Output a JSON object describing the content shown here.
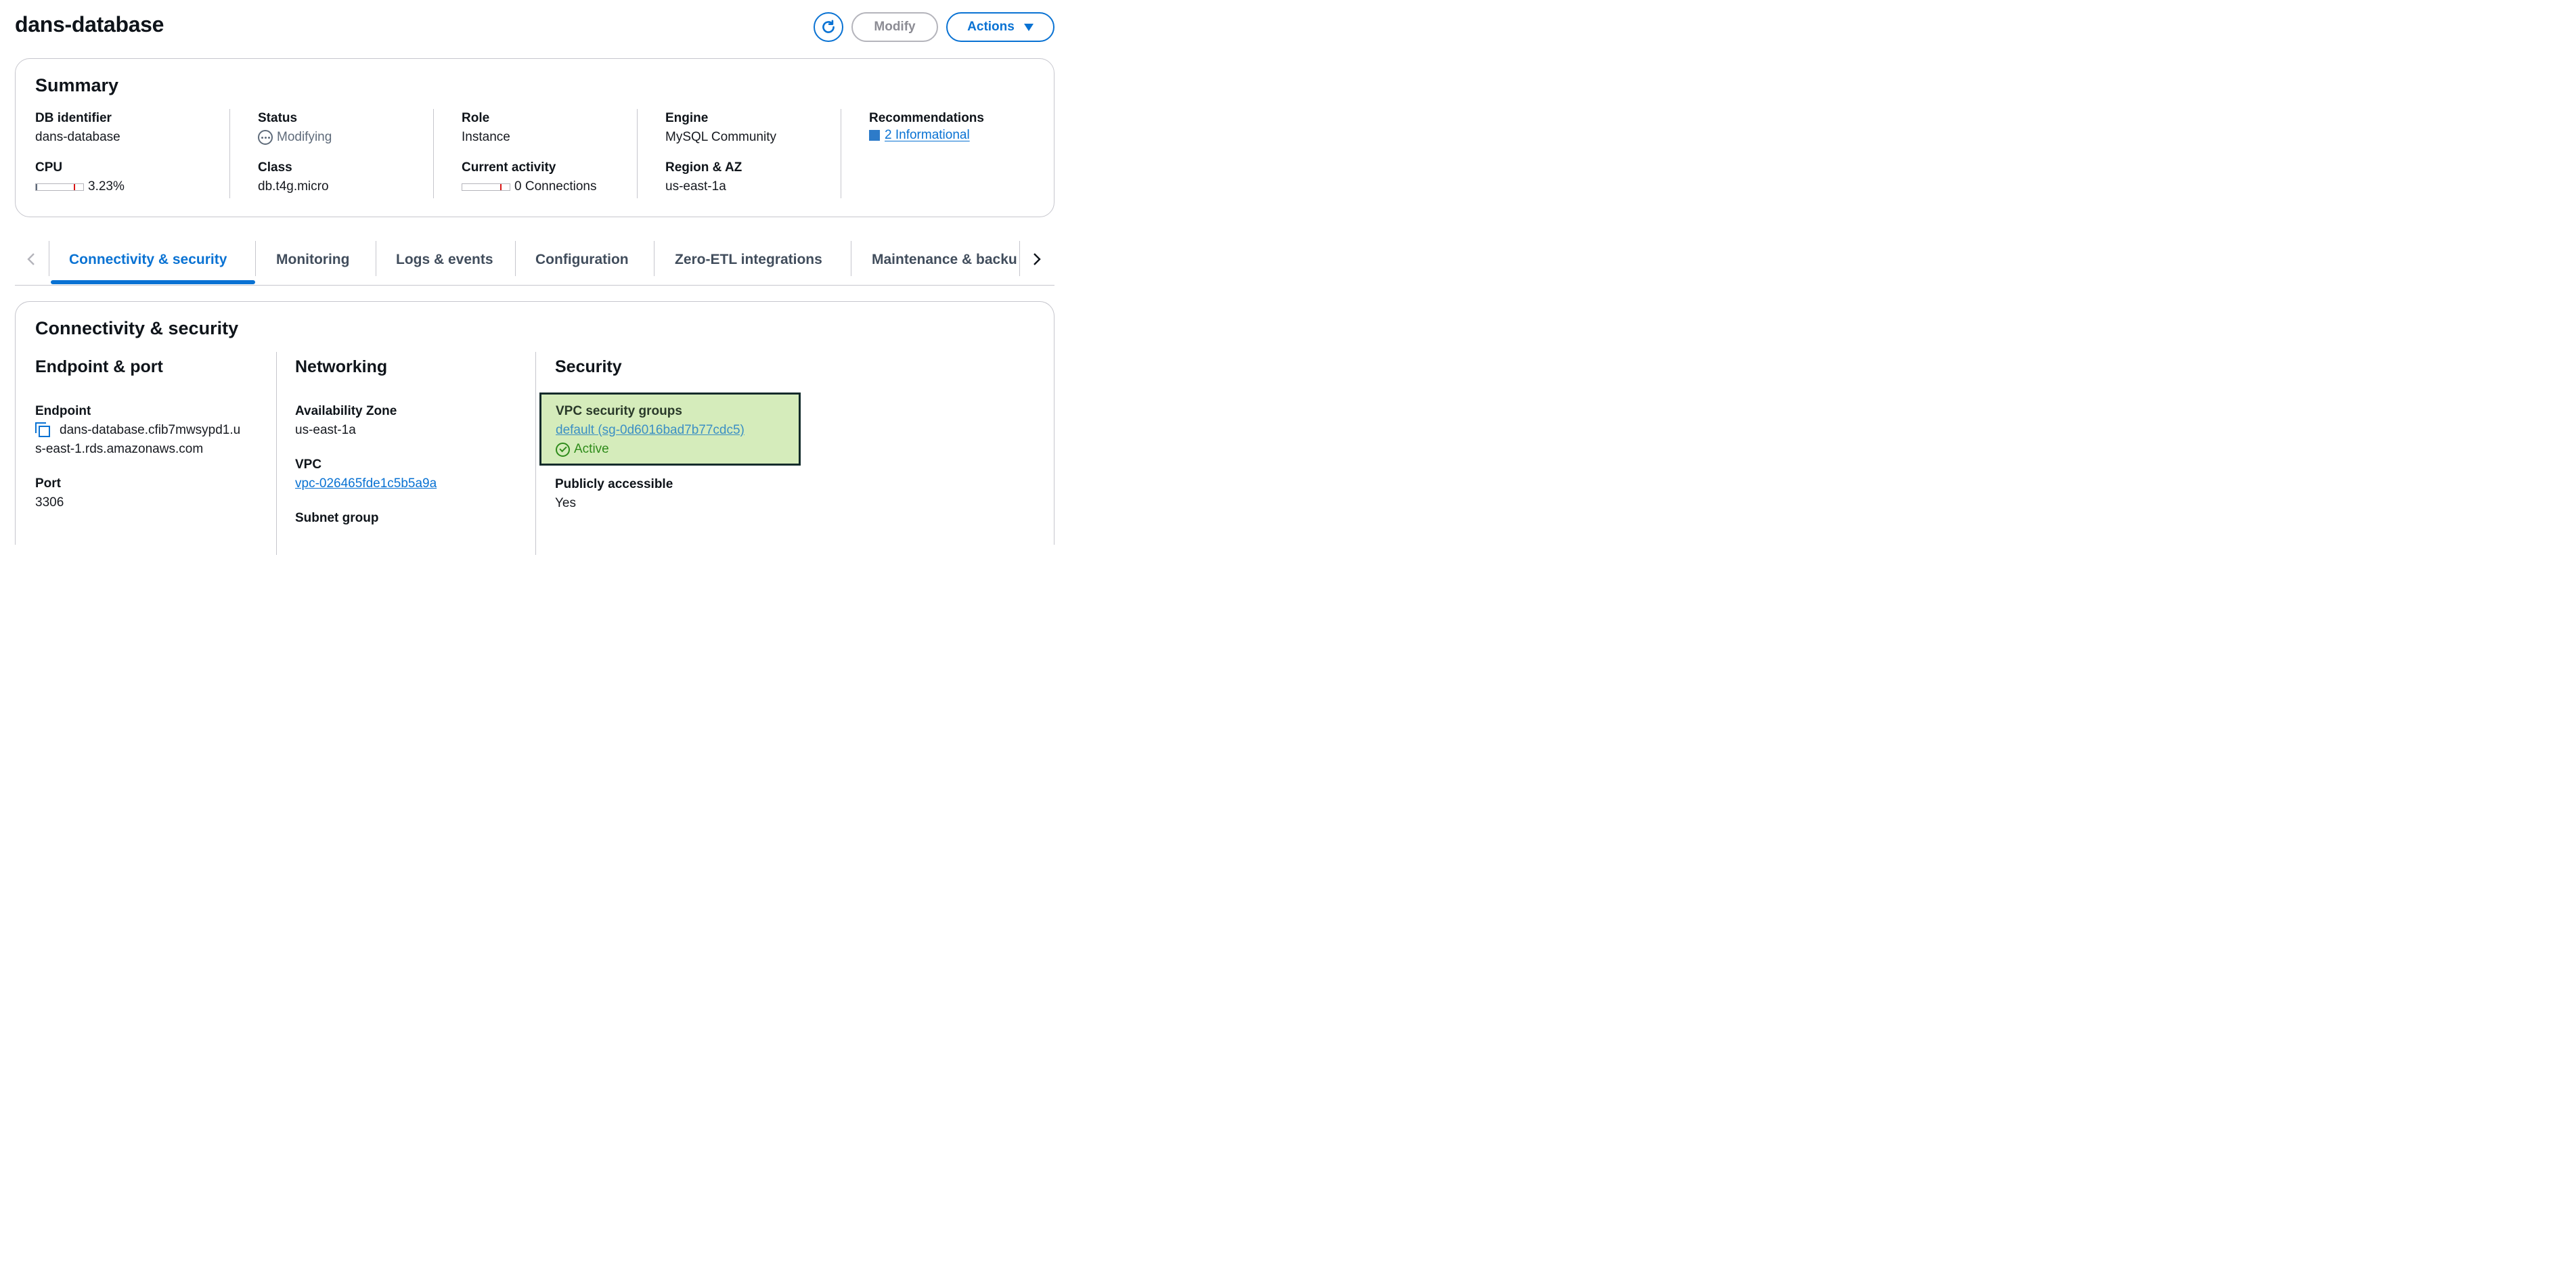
{
  "page": {
    "title": "dans-database"
  },
  "header": {
    "refresh_icon": "refresh-icon",
    "modify_label": "Modify",
    "actions_label": "Actions"
  },
  "summary": {
    "title": "Summary",
    "db_identifier_label": "DB identifier",
    "db_identifier_value": "dans-database",
    "cpu_label": "CPU",
    "cpu_value": "3.23%",
    "cpu_percent": 3.23,
    "status_label": "Status",
    "status_value": "Modifying",
    "class_label": "Class",
    "class_value": "db.t4g.micro",
    "role_label": "Role",
    "role_value": "Instance",
    "current_activity_label": "Current activity",
    "current_activity_value": "0 Connections",
    "engine_label": "Engine",
    "engine_value": "MySQL Community",
    "region_label": "Region & AZ",
    "region_value": "us-east-1a",
    "recommendations_label": "Recommendations",
    "recommendations_value": "2 Informational",
    "recommendations_color": "#2d7bc9"
  },
  "tabs": [
    {
      "label": "Connectivity & security",
      "active": true
    },
    {
      "label": "Monitoring",
      "active": false
    },
    {
      "label": "Logs & events",
      "active": false
    },
    {
      "label": "Configuration",
      "active": false
    },
    {
      "label": "Zero-ETL integrations",
      "active": false
    },
    {
      "label": "Maintenance & backu",
      "active": false
    }
  ],
  "connectivity": {
    "title": "Connectivity & security",
    "endpoint_port": {
      "heading": "Endpoint & port",
      "endpoint_label": "Endpoint",
      "endpoint_line1": "dans-database.cfib7mwsypd1.u",
      "endpoint_line2": "s-east-1.rds.amazonaws.com",
      "port_label": "Port",
      "port_value": "3306"
    },
    "networking": {
      "heading": "Networking",
      "az_label": "Availability Zone",
      "az_value": "us-east-1a",
      "vpc_label": "VPC",
      "vpc_value": "vpc-026465fde1c5b5a9a",
      "subnet_label": "Subnet group"
    },
    "security": {
      "heading": "Security",
      "vpc_sg_label": "VPC security groups",
      "vpc_sg_value": "default (sg-0d6016bad7b77cdc5)",
      "vpc_sg_status": "Active",
      "public_label": "Publicly accessible",
      "public_value": "Yes"
    }
  },
  "colors": {
    "accent": "#0972d3",
    "highlight_bg": "#d5ecbb",
    "active_green": "#2e8b1a"
  }
}
